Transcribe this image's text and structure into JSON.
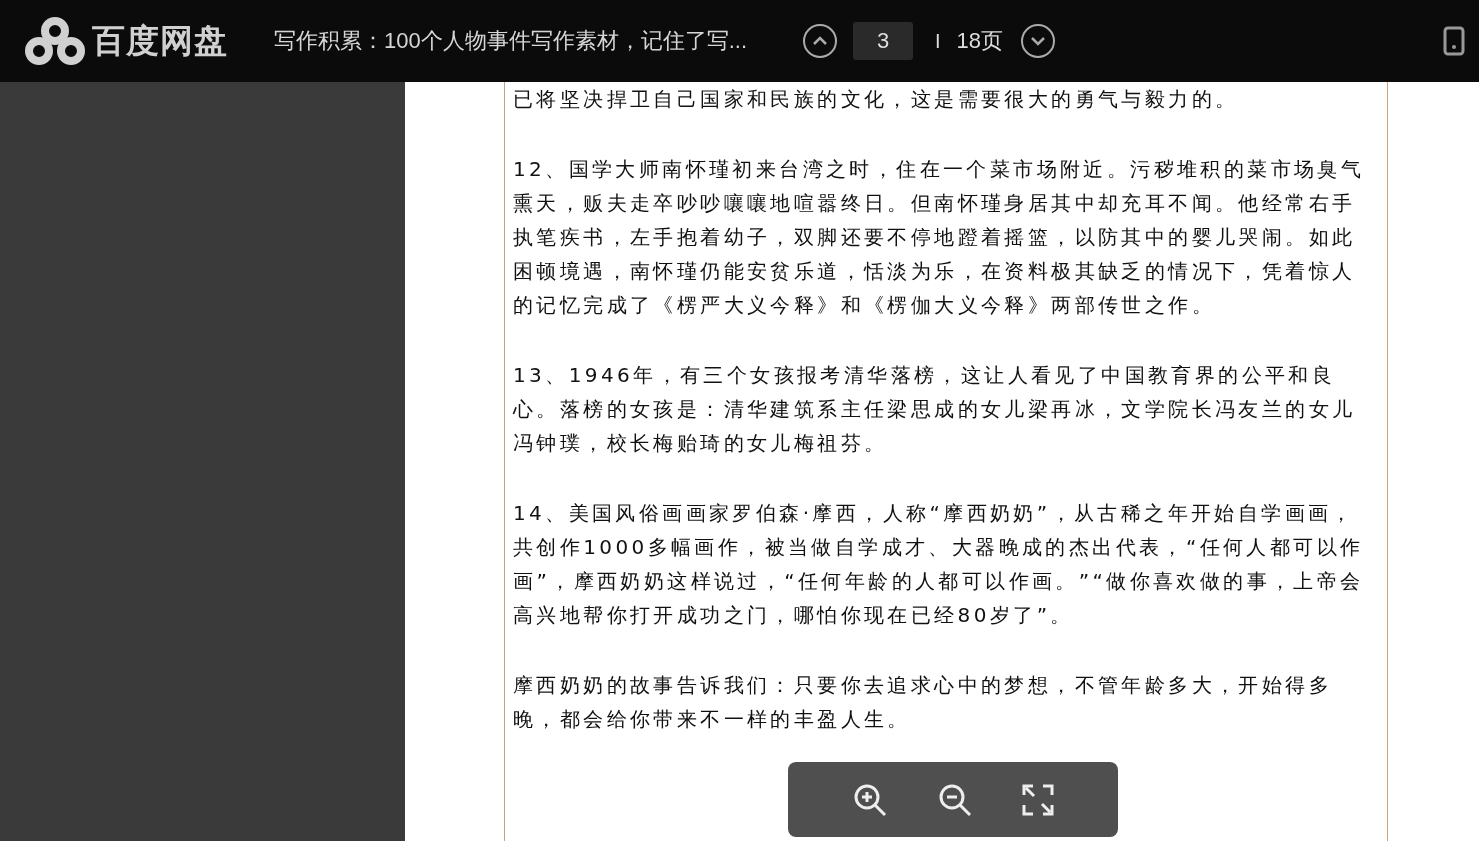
{
  "header": {
    "logo_text": "百度网盘",
    "document_title": "写作积累：100个人物事件写作素材，记住了写...",
    "page_input": {
      "value": "3"
    },
    "separator": "I",
    "page_count": "18页"
  },
  "paragraphs": [
    "已将坚决捍卫自己国家和民族的文化，这是需要很大的勇气与毅力的。",
    "12、国学大师南怀瑾初来台湾之时，住在一个菜市场附近。污秽堆积的菜市场臭气熏天，贩夫走卒吵吵嚷嚷地喧嚣终日。但南怀瑾身居其中却充耳不闻。他经常右手执笔疾书，左手抱着幼子，双脚还要不停地蹬着摇篮，以防其中的婴儿哭闹。如此困顿境遇，南怀瑾仍能安贫乐道，恬淡为乐，在资料极其缺乏的情况下，凭着惊人的记忆完成了《楞严大义今释》和《楞伽大义今释》两部传世之作。",
    "13、1946年，有三个女孩报考清华落榜，这让人看见了中国教育界的公平和良心。落榜的女孩是：清华建筑系主任梁思成的女儿梁再冰，文学院长冯友兰的女儿冯钟璞，校长梅贻琦的女儿梅祖芬。",
    "14、美国风俗画画家罗伯森·摩西，人称“摩西奶奶”，从古稀之年开始自学画画，共创作1000多幅画作，被当做自学成才、大器晚成的杰出代表，“任何人都可以作画”，摩西奶奶这样说过，“任何年龄的人都可以作画。”“做你喜欢做的事，上帝会高兴地帮你打开成功之门，哪怕你现在已经80岁了”。",
    "摩西奶奶的故事告诉我们：只要你去追求心中的梦想，不管年龄多大，开始得多晚，都会给你带来不一样的丰盈人生。"
  ]
}
